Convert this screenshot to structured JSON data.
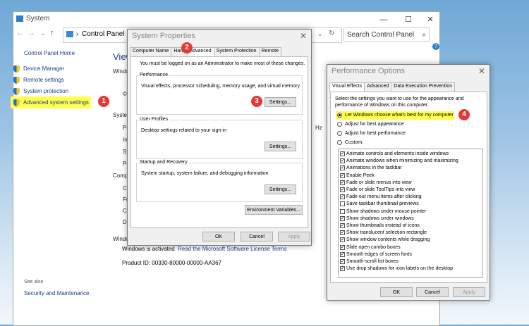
{
  "control_panel": {
    "window_title": "System",
    "breadcrumb": "Control Panel",
    "search_placeholder": "Search Control Panel",
    "home_link": "Control Panel Home",
    "side_links": [
      "Device Manager",
      "Remote settings",
      "System protection",
      "Advanced system settings"
    ],
    "see_also": "See also",
    "security_link": "Security and Maintenance",
    "heading_fragment": "View",
    "fragments": [
      "Windo",
      "©",
      "Syster",
      "Pr",
      "In",
      "Sy",
      "Pe",
      "Computer",
      "Co",
      "Fu",
      "Co",
      "Do",
      "Windo",
      "Hz"
    ],
    "activation_status": "Windows is activated",
    "license_link": "Read the Microsoft Software License Terms",
    "product_id": "Product ID: 00330-80000-00000-AA367"
  },
  "system_properties": {
    "title": "System Properties",
    "tabs": [
      "Computer Name",
      "Hard",
      "Advanced",
      "System Protection",
      "Remote"
    ],
    "admin_note": "You must be logged on as an Administrator to make most of these changes.",
    "performance": {
      "label": "Performance",
      "description": "Visual effects, processor scheduling, memory usage, and virtual memory",
      "button": "Settings..."
    },
    "user_profiles": {
      "label": "User Profiles",
      "description": "Desktop settings related to your sign-in",
      "button": "Settings..."
    },
    "startup_recovery": {
      "label": "Startup and Recovery",
      "description": "System startup, system failure, and debugging information",
      "button": "Settings..."
    },
    "env_button": "Environment Variables...",
    "ok": "OK",
    "cancel": "Cancel",
    "apply": "Apply"
  },
  "performance_options": {
    "title": "Performance Options",
    "tabs": [
      "Visual Effects",
      "Advanced",
      "Data Execution Prevention"
    ],
    "intro": "Select the settings you want to use for the appearance and performance of Windows on this computer.",
    "options": [
      {
        "label": "Let Windows choose what's best for my computer",
        "selected": true
      },
      {
        "label": "Adjust for best appearance",
        "selected": false
      },
      {
        "label": "Adjust for best performance",
        "selected": false
      },
      {
        "label": "Custom:",
        "selected": false
      }
    ],
    "effects": [
      {
        "label": "Animate controls and elements inside windows",
        "checked": true
      },
      {
        "label": "Animate windows when minimizing and maximizing",
        "checked": true
      },
      {
        "label": "Animations in the taskbar",
        "checked": true
      },
      {
        "label": "Enable Peek",
        "checked": true
      },
      {
        "label": "Fade or slide menus into view",
        "checked": true
      },
      {
        "label": "Fade or slide ToolTips into view",
        "checked": true
      },
      {
        "label": "Fade out menu items after clicking",
        "checked": true
      },
      {
        "label": "Save taskbar thumbnail previews",
        "checked": false
      },
      {
        "label": "Show shadows under mouse pointer",
        "checked": false
      },
      {
        "label": "Show shadows under windows",
        "checked": true
      },
      {
        "label": "Show thumbnails instead of icons",
        "checked": true
      },
      {
        "label": "Show translucent selection rectangle",
        "checked": true
      },
      {
        "label": "Show window contents while dragging",
        "checked": true
      },
      {
        "label": "Slide open combo boxes",
        "checked": true
      },
      {
        "label": "Smooth edges of screen fonts",
        "checked": true
      },
      {
        "label": "Smooth-scroll list boxes",
        "checked": true
      },
      {
        "label": "Use drop shadows for icon labels on the desktop",
        "checked": true
      }
    ],
    "ok": "OK",
    "cancel": "Cancel",
    "apply": "Apply"
  },
  "step_badges": [
    "1",
    "2",
    "3",
    "4"
  ],
  "colors": {
    "highlight": "#ffff4d",
    "badge": "#e53935",
    "link": "#1a3e8c"
  }
}
